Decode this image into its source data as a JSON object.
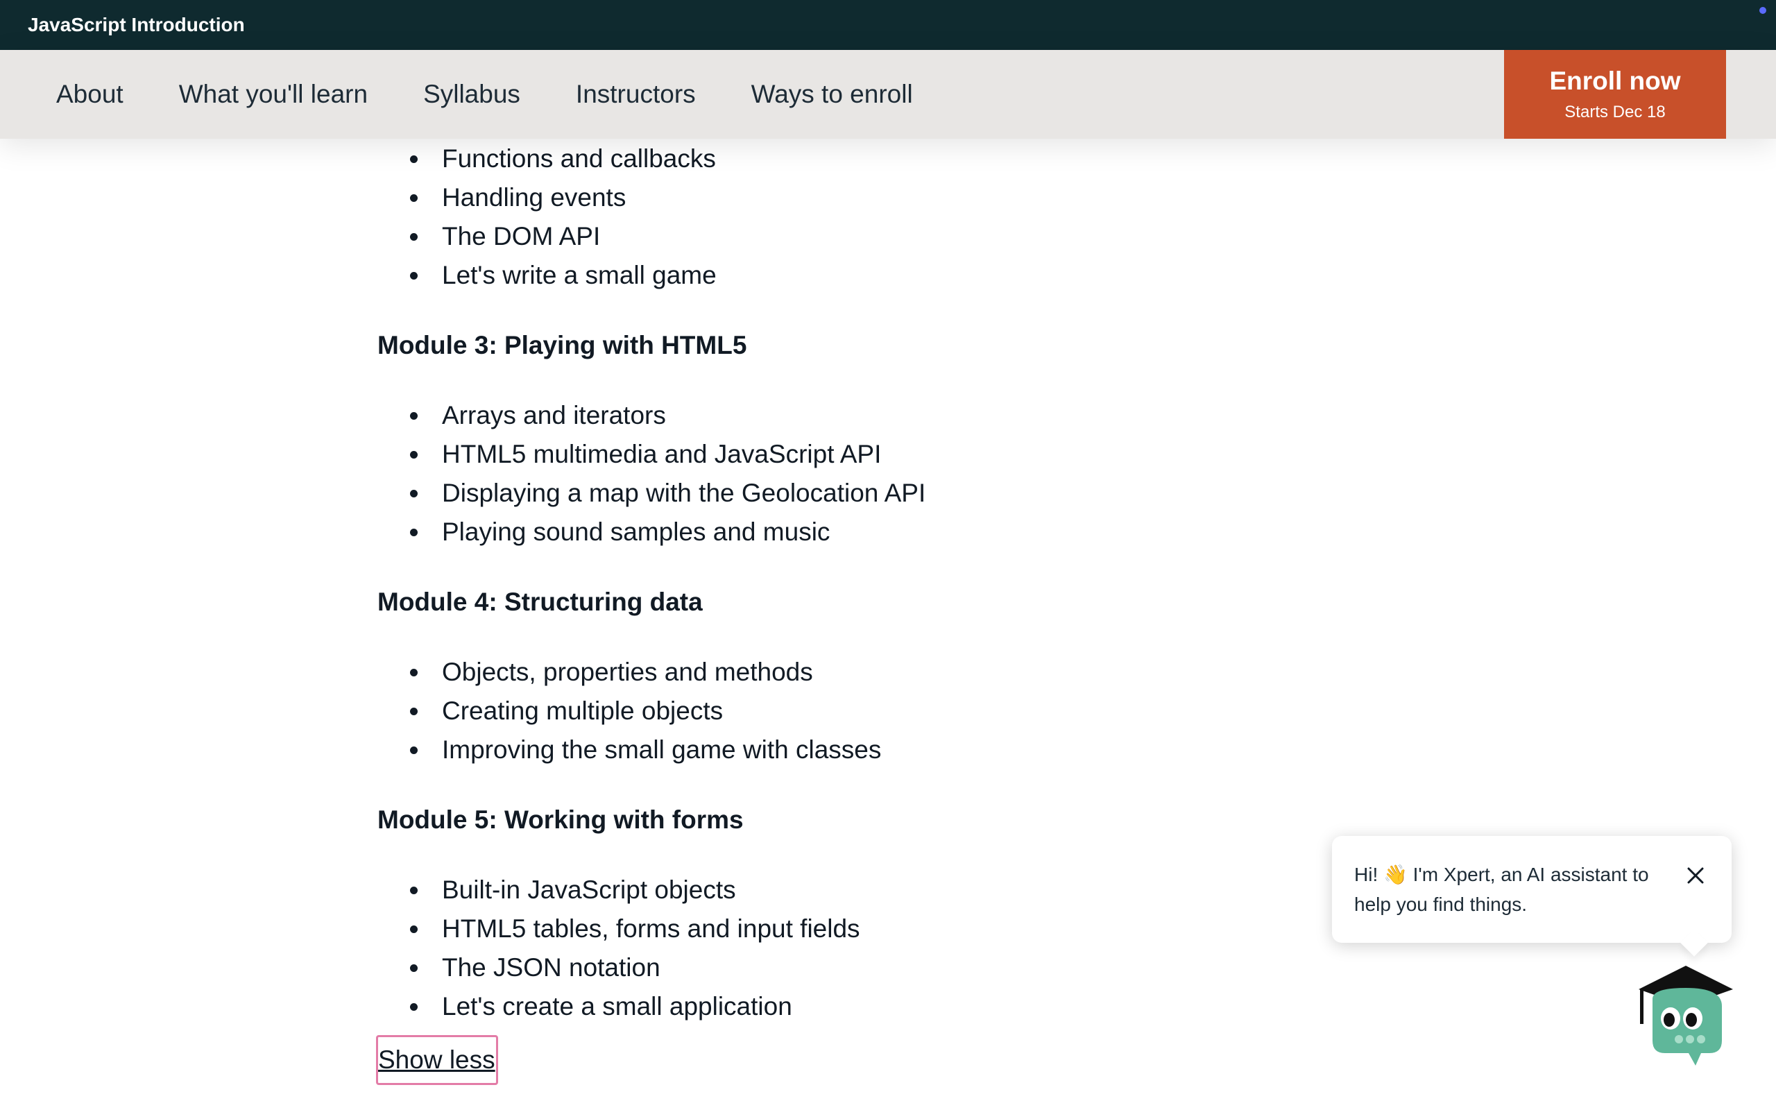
{
  "topbar": {
    "title": "JavaScript Introduction"
  },
  "nav": {
    "items": [
      {
        "label": "About"
      },
      {
        "label": "What you'll learn"
      },
      {
        "label": "Syllabus"
      },
      {
        "label": "Instructors"
      },
      {
        "label": "Ways to enroll"
      }
    ],
    "enroll": {
      "label": "Enroll now",
      "sub": "Starts Dec 18"
    }
  },
  "syllabus": {
    "module2_items": [
      "Functions and callbacks",
      "Handling events",
      "The DOM API",
      "Let's write a small game"
    ],
    "module3": {
      "title": "Module 3: Playing with HTML5",
      "items": [
        "Arrays and iterators",
        "HTML5 multimedia and JavaScript API",
        "Displaying a map with the Geolocation API",
        "Playing sound samples and music"
      ]
    },
    "module4": {
      "title": "Module 4: Structuring data",
      "items": [
        "Objects, properties and methods",
        "Creating multiple objects",
        "Improving the small game with classes"
      ]
    },
    "module5": {
      "title": "Module 5: Working with forms",
      "items": [
        "Built-in JavaScript objects",
        "HTML5 tables, forms and input fields",
        "The JSON notation",
        "Let's create a small application"
      ]
    },
    "show_less": "Show less"
  },
  "assistant": {
    "message": "Hi! 👋 I'm Xpert, an AI assistant to help you find things."
  },
  "colors": {
    "topbar_bg": "#0f2a2f",
    "navbar_bg": "#e8e6e4",
    "enroll_bg": "#c8502a",
    "focus_outline": "#e37ca7",
    "avatar_green": "#5fb79a"
  }
}
